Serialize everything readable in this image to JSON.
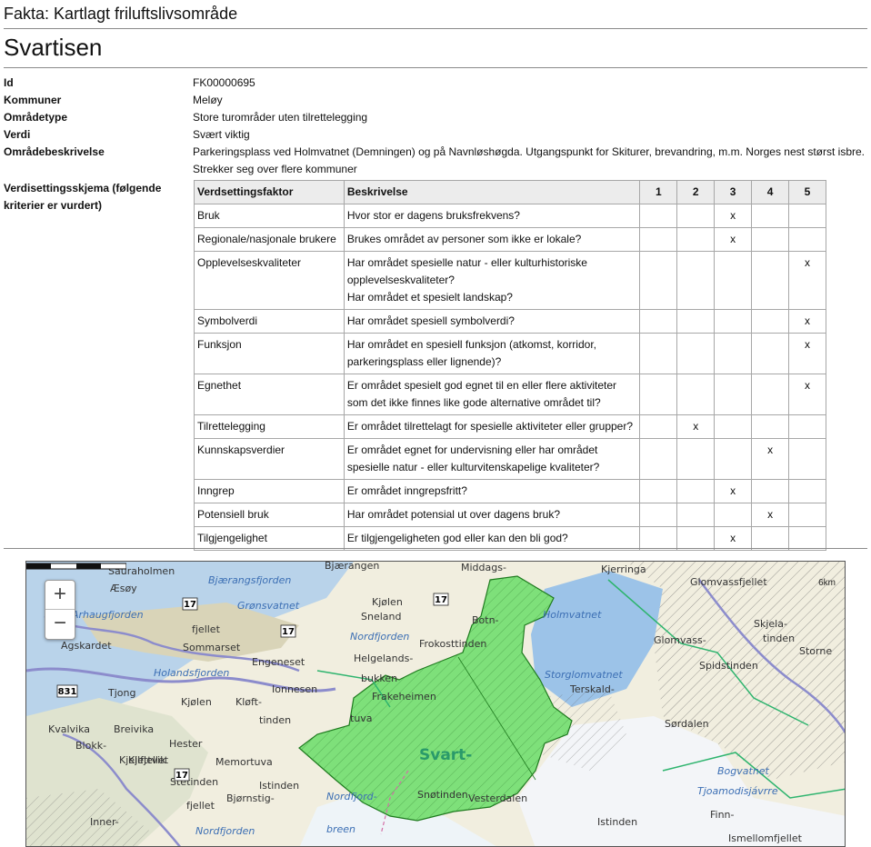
{
  "header": {
    "title": "Fakta: Kartlagt friluftslivsområde"
  },
  "place": {
    "name": "Svartisen"
  },
  "facts": {
    "id": {
      "label": "Id",
      "value": "FK00000695"
    },
    "kommuner": {
      "label": "Kommuner",
      "value": "Meløy"
    },
    "omradetype": {
      "label": "Områdetype",
      "value": "Store turområder uten tilrettelegging"
    },
    "verdi": {
      "label": "Verdi",
      "value": "Svært viktig"
    },
    "beskrivelse": {
      "label": "Områdebeskrivelse",
      "value": "Parkeringsplass ved Holmvatnet (Demningen) og på Navnløshøgda. Utgangspunkt for Skiturer, brevandring, m.m. Norges nest størst isbre. Strekker seg over flere kommuner"
    },
    "skjema": {
      "label": "Verdisettingsskjema (følgende kriterier er vurdert)"
    }
  },
  "table": {
    "headers": {
      "factor": "Verdsettingsfaktor",
      "description": "Beskrivelse",
      "c1": "1",
      "c2": "2",
      "c3": "3",
      "c4": "4",
      "c5": "5"
    },
    "mark": "x",
    "rows": [
      {
        "factor": "Bruk",
        "desc": [
          "Hvor stor er dagens bruksfrekvens?"
        ],
        "score": 3
      },
      {
        "factor": "Regionale/nasjonale brukere",
        "desc": [
          "Brukes området av personer som ikke er lokale?"
        ],
        "score": 3
      },
      {
        "factor": "Opplevelseskvaliteter",
        "desc": [
          "Har området spesielle natur - eller kulturhistoriske opplevelseskvaliteter?",
          "Har området et spesielt landskap?"
        ],
        "score": 5
      },
      {
        "factor": "Symbolverdi",
        "desc": [
          "Har området spesiell symbolverdi?"
        ],
        "score": 5
      },
      {
        "factor": "Funksjon",
        "desc": [
          "Har området en spesiell funksjon (atkomst, korridor, parkeringsplass eller lignende)?"
        ],
        "score": 5
      },
      {
        "factor": "Egnethet",
        "desc": [
          "Er området spesielt god egnet til en eller flere aktiviteter som det ikke finnes like gode alternative området til?"
        ],
        "score": 5
      },
      {
        "factor": "Tilrettelegging",
        "desc": [
          "Er området tilrettelagt for spesielle aktiviteter eller grupper?"
        ],
        "score": 2
      },
      {
        "factor": "Kunnskapsverdier",
        "desc": [
          "Er området egnet for undervisning eller har området spesielle natur - eller kulturvitenskapelige kvaliteter?"
        ],
        "score": 4
      },
      {
        "factor": "Inngrep",
        "desc": [
          "Er området inngrepsfritt?"
        ],
        "score": 3
      },
      {
        "factor": "Potensiell bruk",
        "desc": [
          "Har området potensial ut over dagens bruk?"
        ],
        "score": 4
      },
      {
        "factor": "Tilgjengelighet",
        "desc": [
          "Er tilgjengeligheten god eller kan den bli god?"
        ],
        "score": 3
      }
    ]
  },
  "map": {
    "zoom_in": "+",
    "zoom_out": "−",
    "scale_label": "6km",
    "area_label": "Svart-",
    "colors": {
      "area_fill": "#7ee07a",
      "area_stroke": "#1e7a1e",
      "water": "#b9d3ea",
      "lake": "#9cc3e8",
      "boundary": "#8c8ccc",
      "land": "#f1eedf"
    },
    "labels": [
      "Sauraholmen",
      "Æsøy",
      "Bjærangsfjorden",
      "Bjærangen",
      "Middags-",
      "Kjerringa",
      "Glomvassfjellet",
      "Arhaugfjorden",
      "Grønsvatnet",
      "Kjølen",
      "Sneland",
      "Botn-",
      "Holmvatnet",
      "Skjela-",
      "tinden",
      "fjellet",
      "Nordfjorden",
      "Frokosttinden",
      "Glomvass-",
      "Storne",
      "Agskardet",
      "Sommarset",
      "Engeneset",
      "Helgelands-",
      "bukken",
      "Storglomvatnet",
      "Spidstinden",
      "Holandsfjorden",
      "Tjong",
      "Kjølen",
      "Kløft-",
      "Ionnesen",
      "Frakeheimen",
      "Terskald-",
      "Kvalvika",
      "Breivika",
      "tinden",
      "tuva",
      "Kjellfjellet",
      "Hester",
      "Blokk-",
      "Kjettvik",
      "Memortuva",
      "Sørdalen",
      "Bogvatnet",
      "Istinden",
      "Stetinden",
      "Snøtinden",
      "Tjoamodisjávrre",
      "fjellet",
      "Bjørnstig-",
      "Nordfjord-",
      "breen",
      "Vesterdalen",
      "Istinden",
      "Finn-",
      "Inner-",
      "Ismellomfjellet",
      "Nordfjorden"
    ],
    "road_numbers": [
      "17",
      "17",
      "17",
      "17",
      "831"
    ]
  }
}
